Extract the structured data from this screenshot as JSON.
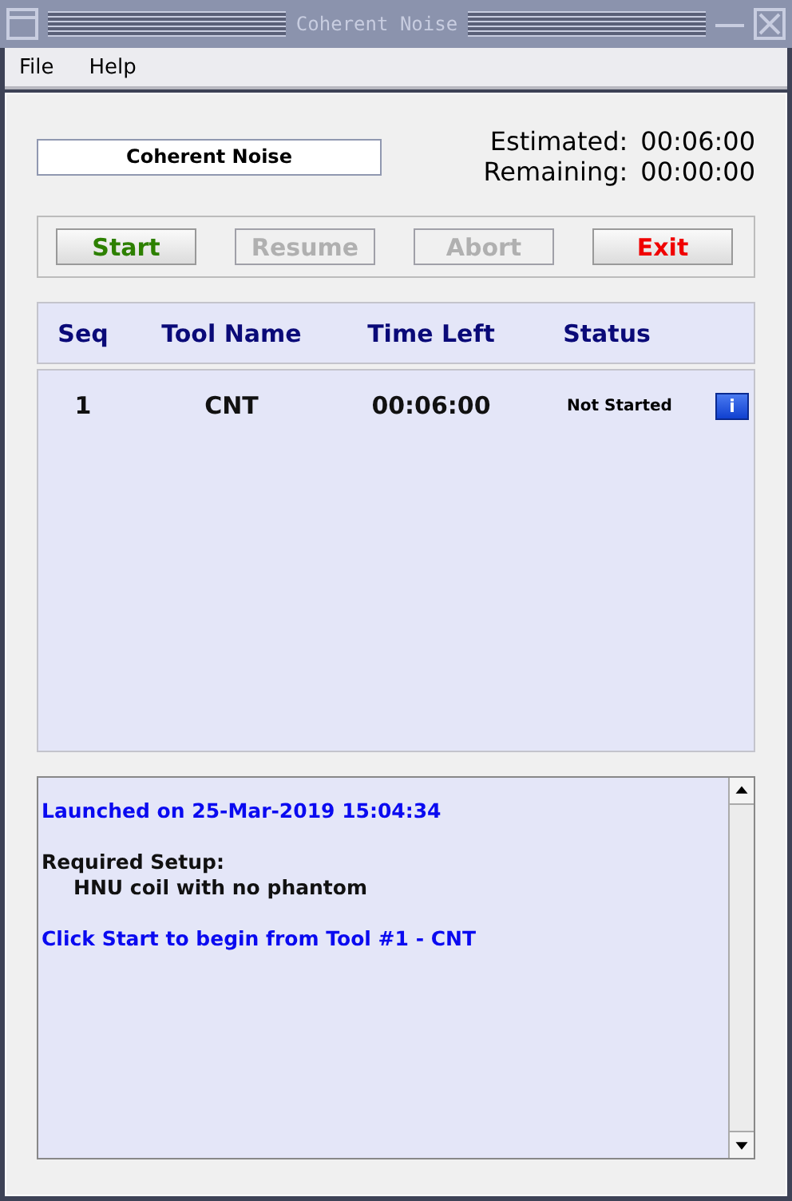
{
  "window": {
    "title": "Coherent Noise"
  },
  "menu": [
    "File",
    "Help"
  ],
  "protocol_name": "Coherent Noise",
  "times": [
    {
      "label": "Estimated:",
      "value": "00:06:00"
    },
    {
      "label": "Remaining:",
      "value": "00:00:00"
    }
  ],
  "buttons": [
    {
      "label": "Start",
      "kind": "go",
      "disabled": false
    },
    {
      "label": "Resume",
      "kind": "plain",
      "disabled": true
    },
    {
      "label": "Abort",
      "kind": "plain",
      "disabled": true
    },
    {
      "label": "Exit",
      "kind": "stop",
      "disabled": false
    }
  ],
  "table": {
    "columns": [
      "Seq",
      "Tool Name",
      "Time Left",
      "Status"
    ],
    "rows": [
      {
        "seq": "1",
        "tool": "CNT",
        "time_left": "00:06:00",
        "status": "Not Started",
        "info": "i"
      }
    ]
  },
  "log": [
    {
      "kind": "notice",
      "text": "Launched on 25-Mar-2019 15:04:34"
    },
    {
      "kind": "heading",
      "text": "Required Setup:"
    },
    {
      "kind": "detail",
      "text": "HNU coil with no phantom"
    },
    {
      "kind": "notice",
      "text": "Click Start to begin from Tool #1 - CNT"
    }
  ]
}
